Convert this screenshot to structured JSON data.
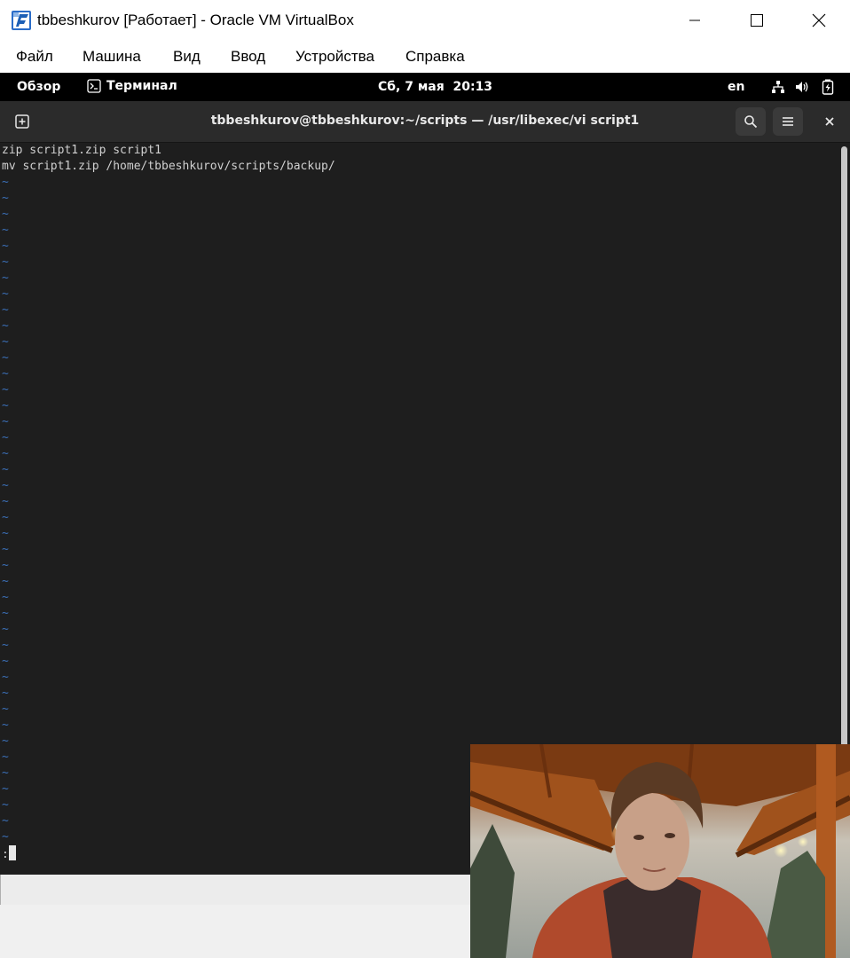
{
  "window": {
    "title": "tbbeshkurov [Работает] - Oracle VM VirtualBox",
    "icons": [
      "virtualbox-icon",
      "minimize-icon",
      "maximize-icon",
      "close-icon"
    ]
  },
  "menubar": {
    "items": [
      "Файл",
      "Машина",
      "Вид",
      "Ввод",
      "Устройства",
      "Справка"
    ]
  },
  "gnome": {
    "overview": "Обзор",
    "app": "Терминал",
    "clock": "Сб, 7 мая  20:13",
    "lang": "en",
    "icons": [
      "terminal-app-icon",
      "network-icon",
      "volume-icon",
      "battery-icon"
    ]
  },
  "terminal": {
    "title": "tbbeshkurov@tbbeshkurov:~/scripts — /usr/libexec/vi script1",
    "lines": [
      "zip script1.zip script1",
      "mv script1.zip /home/tbbeshkurov/scripts/backup/"
    ],
    "tilde": "~",
    "tilde_count": 42,
    "command_prompt": ":",
    "icons": [
      "new-tab-icon",
      "search-icon",
      "hamburger-menu-icon",
      "close-icon"
    ]
  },
  "colors": {
    "terminal_bg": "#1e1e1e",
    "header_bg": "#2b2b2b",
    "tilde": "#3b6fb6",
    "gnome_bar": "#000000"
  }
}
